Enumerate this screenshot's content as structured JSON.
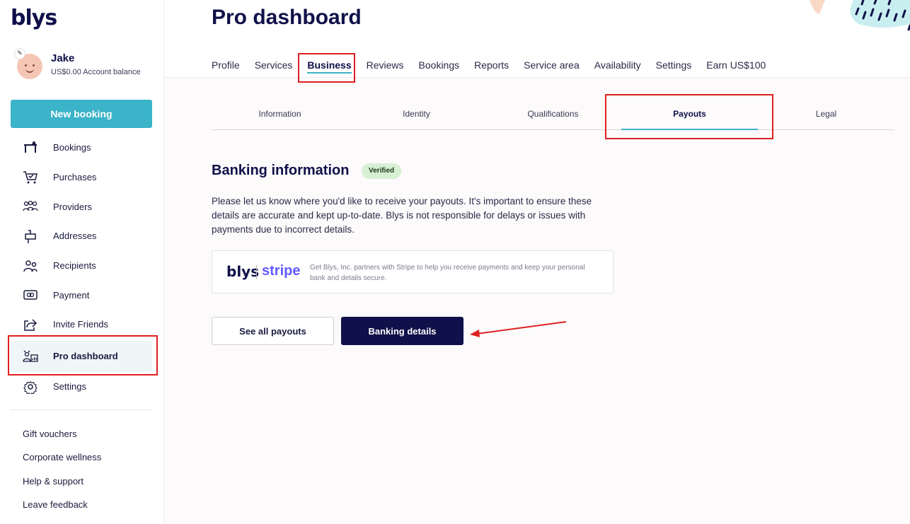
{
  "brand": {
    "logo": "blys",
    "accent": "#3bb3c8",
    "dark": "#10104a",
    "highlight": "#e02020"
  },
  "user": {
    "name": "Jake",
    "balance": "US$0.00 Account balance"
  },
  "sidebar": {
    "new_booking_label": "New booking",
    "items": [
      {
        "label": "Bookings",
        "icon": "massage-table-icon"
      },
      {
        "label": "Purchases",
        "icon": "cart-icon"
      },
      {
        "label": "Providers",
        "icon": "group-icon"
      },
      {
        "label": "Addresses",
        "icon": "mailbox-icon"
      },
      {
        "label": "Recipients",
        "icon": "people-icon"
      },
      {
        "label": "Payment",
        "icon": "credit-card-icon"
      },
      {
        "label": "Invite Friends",
        "icon": "share-icon"
      },
      {
        "label": "Pro dashboard",
        "icon": "pro-dashboard-icon",
        "active": true
      },
      {
        "label": "Settings",
        "icon": "gear-icon"
      }
    ],
    "footer_links": [
      "Gift vouchers",
      "Corporate wellness",
      "Help & support",
      "Leave feedback"
    ]
  },
  "main": {
    "title": "Pro dashboard",
    "tabs": [
      "Profile",
      "Services",
      "Business",
      "Reviews",
      "Bookings",
      "Reports",
      "Service area",
      "Availability",
      "Settings",
      "Earn US$100"
    ],
    "active_tab": "Business",
    "sub_tabs": [
      "Information",
      "Identity",
      "Qualifications",
      "Payouts",
      "Legal"
    ],
    "active_sub_tab": "Payouts",
    "banking": {
      "title": "Banking information",
      "badge": "Verified",
      "description": "Please let us know where you'd like to receive your payouts. It's important to ensure these details are accurate and kept up-to-date. Blys is not responsible for delays or issues with payments due to incorrect details.",
      "partner_logo_blys": "blys",
      "partner_logo_stripe": "stripe",
      "partner_text": "Get Blys, Inc. partners with Stripe to help you receive payments and keep your personal bank and details secure."
    },
    "buttons": {
      "see_all_payouts": "See all payouts",
      "banking_details": "Banking details"
    }
  }
}
